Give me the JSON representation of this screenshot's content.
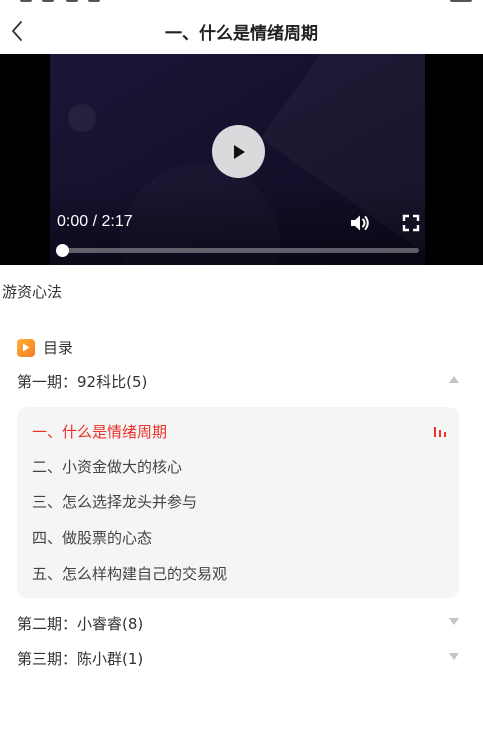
{
  "header": {
    "title": "一、什么是情绪周期"
  },
  "player": {
    "current_time": "0:00",
    "separator": " / ",
    "duration": "2:17",
    "progress": 0.0
  },
  "course": {
    "name": "游资心法"
  },
  "catalog": {
    "label": "目录",
    "sections": [
      {
        "title": "第一期：92科比(5)",
        "expanded": true,
        "lessons": [
          {
            "label": "一、什么是情绪周期",
            "active": true
          },
          {
            "label": "二、小资金做大的核心",
            "active": false
          },
          {
            "label": "三、怎么选择龙头并参与",
            "active": false
          },
          {
            "label": "四、做股票的心态",
            "active": false
          },
          {
            "label": "五、怎么样构建自己的交易观",
            "active": false
          }
        ]
      },
      {
        "title": "第二期：小睿睿(8)",
        "expanded": false
      },
      {
        "title": "第三期：陈小群(1)",
        "expanded": false
      }
    ]
  },
  "icons": {
    "back": "chevron-left-icon",
    "play": "play-icon",
    "volume": "volume-icon",
    "fullscreen": "fullscreen-icon",
    "catalog": "catalog-icon",
    "playing": "playing-bars-icon"
  },
  "colors": {
    "accent": "#e8322b",
    "catalog_icon": "#f5902a",
    "lesson_bg": "#f5f5f5"
  }
}
